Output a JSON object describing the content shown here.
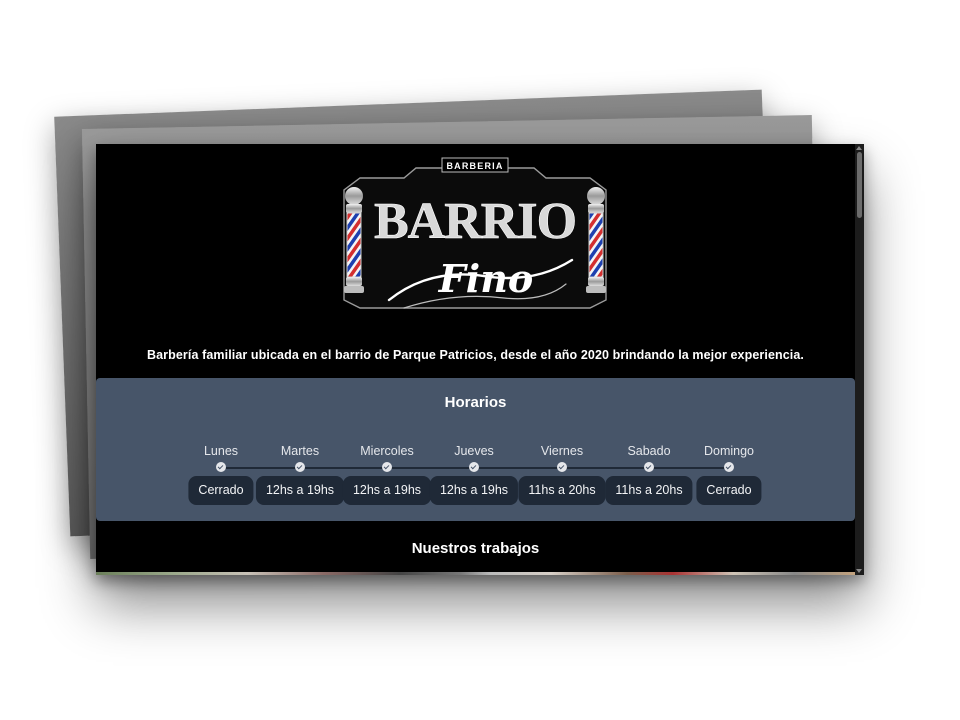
{
  "logo": {
    "top_label": "BARBERIA",
    "main_text": "BARRIO",
    "script_text": "Fino"
  },
  "tagline": "Barbería familiar ubicada en el barrio de Parque Patricios, desde el año 2020 brindando la mejor experiencia.",
  "schedule": {
    "title": "Horarios",
    "days": [
      {
        "name": "Lunes",
        "hours": "Cerrado"
      },
      {
        "name": "Martes",
        "hours": "12hs a 19hs"
      },
      {
        "name": "Miercoles",
        "hours": "12hs a 19hs"
      },
      {
        "name": "Jueves",
        "hours": "12hs a 19hs"
      },
      {
        "name": "Viernes",
        "hours": "11hs a 20hs"
      },
      {
        "name": "Sabado",
        "hours": "11hs a 20hs"
      },
      {
        "name": "Domingo",
        "hours": "Cerrado"
      }
    ]
  },
  "works": {
    "title": "Nuestros trabajos"
  },
  "colors": {
    "page_background": "#000000",
    "panel": "#475569",
    "pill": "#1f2937",
    "barber_red": "#d32f2f",
    "barber_blue": "#1e40af"
  }
}
